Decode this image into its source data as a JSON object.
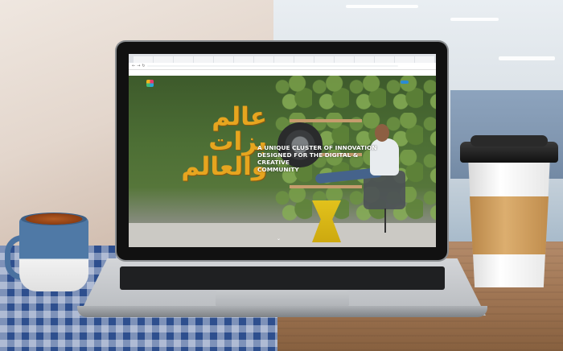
{
  "browser": {
    "tabs": [
      "",
      "",
      "",
      "",
      "",
      "",
      "",
      "",
      "",
      "",
      "",
      "",
      "",
      "",
      ""
    ],
    "url": "",
    "bookmarks": [
      "",
      "",
      "",
      "",
      "",
      "",
      "",
      "",
      "",
      "",
      ""
    ]
  },
  "site": {
    "logo_text": "",
    "nav_items": [
      "",
      "",
      "",
      "",
      ""
    ],
    "cta_label": "",
    "arabic_line1": "عالم بزات",
    "arabic_line2": "والعالم",
    "tagline_line1": "A UNIQUE CLUSTER OF INNOVATION",
    "tagline_line2": "DESIGNED FOR THE DIGITAL & CREATIVE",
    "tagline_line3": "COMMUNITY"
  },
  "icons": {
    "scroll": "chevron-down-icon",
    "logo": "cluster-logo-icon"
  },
  "colors": {
    "arabic_title": "#e6a51f",
    "cta": "#2a8bd6"
  }
}
